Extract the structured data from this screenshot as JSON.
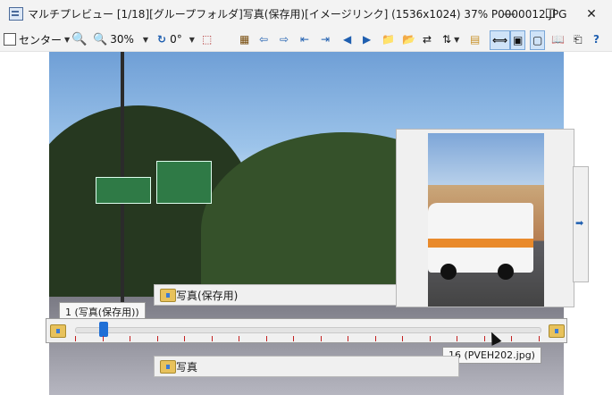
{
  "window": {
    "title": "マルチプレビュー [1/18][グループフォルダ]写真(保存用)[イメージリンク] (1536x1024) 37% P0000012.JPG",
    "minimize": "—",
    "maximize": "☐",
    "close": "✕"
  },
  "toolbar": {
    "align_label": "センター",
    "zoom_label": "30%",
    "rotate_label": "0°"
  },
  "panels": {
    "upper_folder_label": "写真(保存用)",
    "lower_folder_label": "写真"
  },
  "tooltips": {
    "current": "1 (写真(保存用))",
    "hover": "16 (PVEH202.jpg)"
  },
  "slider": {
    "position": 1,
    "total": 18
  },
  "colors": {
    "accent": "#1f6fd6",
    "tick": "#c42020"
  }
}
